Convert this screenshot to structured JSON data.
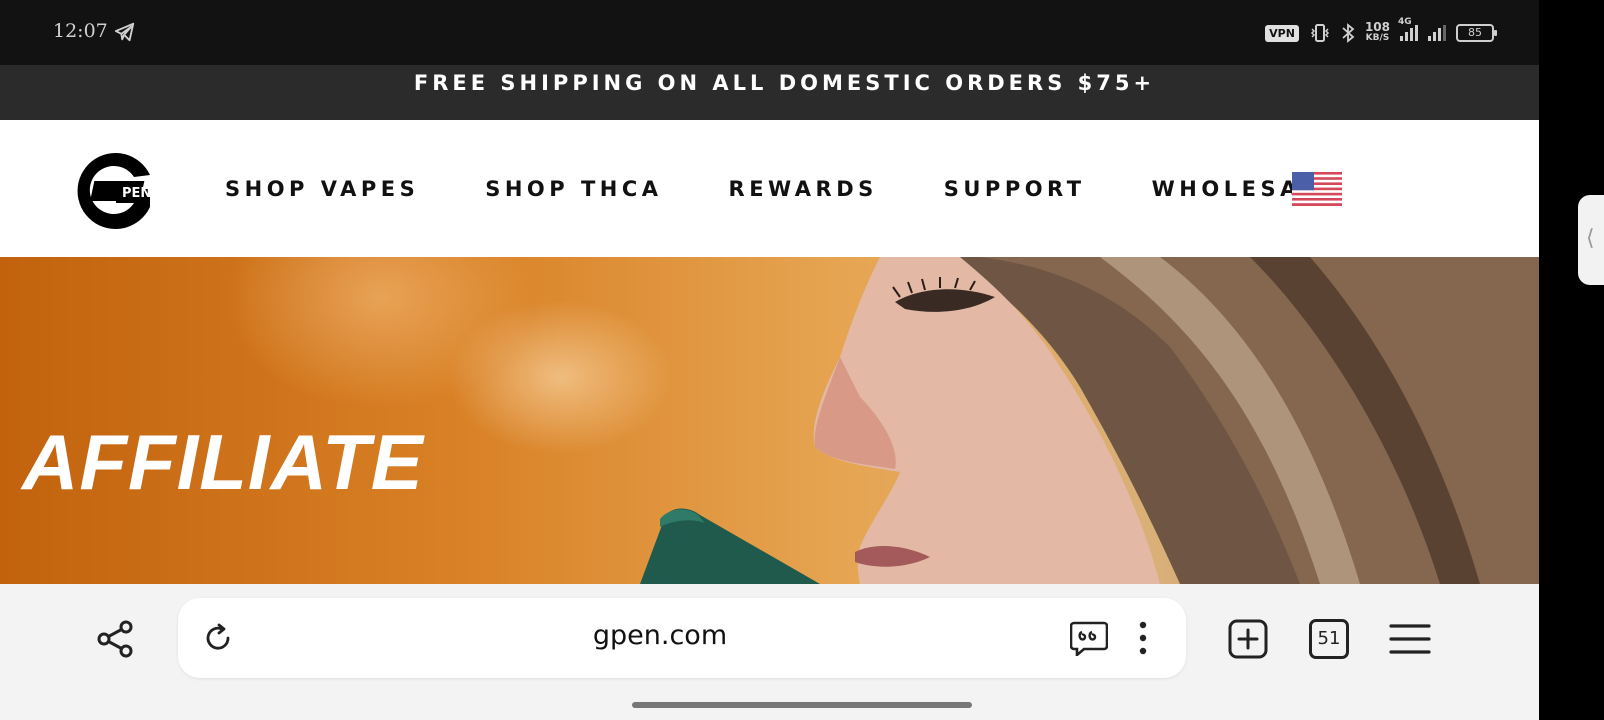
{
  "status_bar": {
    "time": "12:07",
    "vpn": "VPN",
    "speed_value": "108",
    "speed_unit": "KB/S",
    "network": "4G",
    "battery": "85"
  },
  "promo": {
    "text": "FREE SHIPPING ON ALL DOMESTIC ORDERS $75+"
  },
  "header": {
    "nav": [
      "SHOP VAPES",
      "SHOP THCA",
      "REWARDS",
      "SUPPORT",
      "WHOLESALE"
    ],
    "logo_text": "PEN"
  },
  "hero": {
    "title": "AFFILIATE"
  },
  "browser": {
    "url": "gpen.com",
    "tab_count": "51"
  },
  "colors": {
    "status_bg": "#121212",
    "promo_bg": "#2b2b2b",
    "header_bg": "#ffffff",
    "hero_orange": "#d98126",
    "toolbar_bg": "#f3f3f3"
  }
}
